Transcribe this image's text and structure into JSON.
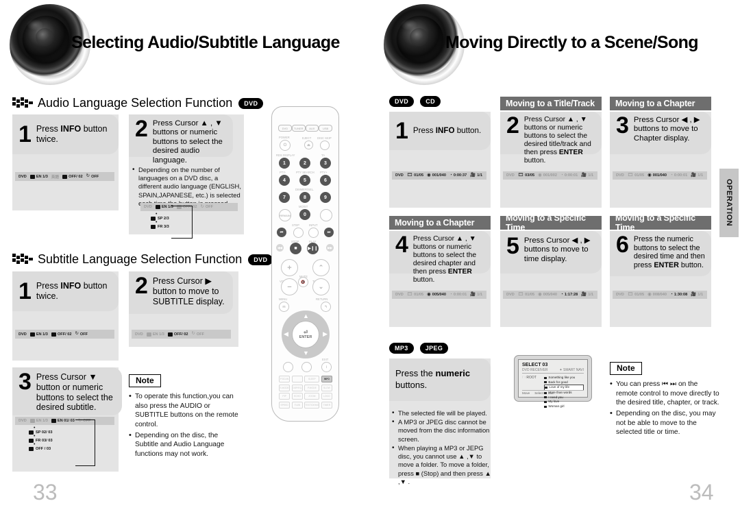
{
  "left_page": {
    "title": "Selecting Audio/Subtitle Language",
    "page_number": "33",
    "sections": [
      {
        "heading": "Audio Language Selection Function",
        "disc": "DVD",
        "steps": [
          {
            "num": "1",
            "text_plain": "Press ",
            "bold": "INFO",
            "text_rest": " button twice."
          },
          {
            "num": "2",
            "text": "Press Cursor ▲ , ▼ buttons or numeric buttons to select the desired audio language."
          }
        ],
        "step2_note": "Depending on the number of languages on a DVD disc, a different audio language (ENGLISH, SPAIN,JAPANESE, etc.) is selected each time the button is pressed.",
        "osd_step1": {
          "disc": "DVD",
          "audio": "EN 1/3",
          "audio_alt": "英語",
          "subtitle": "OFF/ 02",
          "repeat": "OFF"
        },
        "osd_step2": {
          "disc": "DVD",
          "audio": "EN 1/3",
          "subtitle": "OFF/ 02",
          "repeat": "OFF",
          "chain": [
            "SP 2/3",
            "FR 3/3"
          ]
        }
      },
      {
        "heading": "Subtitle Language Selection Function",
        "disc": "DVD",
        "steps": [
          {
            "num": "1",
            "text_plain": "Press ",
            "bold": "INFO",
            "text_rest": " button twice."
          },
          {
            "num": "2",
            "text": "Press Cursor ▶ button to move to SUBTITLE display."
          },
          {
            "num": "3",
            "text": "Press Cursor ▼ button or numeric buttons to select the desired subtitle."
          }
        ],
        "osd_step1": {
          "disc": "DVD",
          "audio": "EN 1/3",
          "subtitle": "OFF/ 02",
          "repeat": "OFF"
        },
        "osd_step2": {
          "disc": "DVD",
          "audio": "EN 1/3",
          "subtitle": "OFF/ 02",
          "repeat": "OFF"
        },
        "osd_step3": {
          "disc": "DVD",
          "audio": "EN 1/3",
          "subtitle": "EN 01/ 03",
          "repeat": "OFF",
          "chain": [
            "SP 02/ 03",
            "FR 03/ 03",
            "OFF / 03"
          ]
        },
        "note": {
          "badge": "Note",
          "items": [
            "To operate this function,you can also press the AUDIO or SUBTITLE buttons on the remote control.",
            "Depending on the disc, the Subtitle and Audio Language functions may not work."
          ]
        }
      }
    ]
  },
  "right_page": {
    "title": "Moving Directly to a Scene/Song",
    "page_number": "34",
    "disc_pills": [
      "DVD",
      "CD"
    ],
    "columns": [
      {
        "caption": "",
        "step_num": "1",
        "step_prefix": "Press ",
        "step_bold": "INFO",
        "step_suffix": " button.",
        "osd": {
          "disc": "DVD",
          "title": "01/05",
          "chapter": "001/040",
          "time": "0:00:37",
          "audio": "1/1",
          "highlight": "disc"
        }
      },
      {
        "caption": "Moving to a Title/Track",
        "step_num": "2",
        "step_text_1": "Press Cursor ▲ , ▼ buttons or numeric buttons to select the desired title/track and then press ",
        "step_bold": "ENTER",
        "step_text_2": " button.",
        "osd": {
          "disc": "DVD",
          "title": "03/05",
          "chapter": "001/002",
          "time": "0:00:01",
          "audio": "1/1",
          "highlight": "title"
        }
      },
      {
        "caption": "Moving to a Chapter",
        "step_num": "3",
        "step_text": "Press Cursor ◀ , ▶ buttons to move to Chapter display.",
        "osd": {
          "disc": "DVD",
          "title": "01/05",
          "chapter": "001/040",
          "time": "0:00:01",
          "audio": "1/1",
          "highlight": "chapter"
        }
      },
      {
        "caption": "Moving to a Chapter",
        "step_num": "4",
        "step_text_1": "Press Cursor ▲ , ▼ buttons or numeric buttons to select the desired chapter and then press ",
        "step_bold": "ENTER",
        "step_text_2": " button.",
        "osd": {
          "disc": "DVD",
          "title": "01/05",
          "chapter": "005/040",
          "time": "0:00:01",
          "audio": "1/1",
          "highlight": "chapter"
        }
      },
      {
        "caption": "Moving to a Specific Time",
        "step_num": "5",
        "step_text": "Press Cursor ◀ , ▶ buttons to move to time display.",
        "osd": {
          "disc": "DVD",
          "title": "01/05",
          "chapter": "005/040",
          "time": "1:17:28",
          "audio": "1/1",
          "highlight": "time"
        }
      },
      {
        "caption": "Moving to a Specific Time",
        "step_num": "6",
        "step_text_1": "Press the numeric buttons to select the desired time and then press ",
        "step_bold": "ENTER",
        "step_text_2": " button.",
        "osd": {
          "disc": "DVD",
          "title": "01/05",
          "chapter": "008/040",
          "time": "1:30:08",
          "audio": "1/1",
          "highlight": "time"
        }
      }
    ],
    "mp3_section": {
      "pills": [
        "MP3",
        "JPEG"
      ],
      "step_prefix": "Press the ",
      "step_bold": "numeric",
      "step_suffix": " buttons.",
      "bullets": [
        "The selected file will be played.",
        "A MP3 or JPEG disc cannot be moved from the disc information screen.",
        "When playing a MP3 or JEPG disc, you cannot use ▲ ,▼  to move a folder. To move a folder, press ■ (Stop) and then press ▲ ,▼ ."
      ],
      "tv_screen": {
        "title": "SELECT  03",
        "device": "DVD RECEIVER",
        "brand": "✦ SMART NAVI",
        "folder": "ROOT",
        "files": [
          "Something like you",
          "Back for good",
          "Love of my life",
          "More than words",
          "I need you",
          "My love",
          "Woman girl"
        ],
        "selected_index": 2,
        "footer": [
          "Move",
          "Select",
          "Exit"
        ]
      }
    },
    "note": {
      "badge": "Note",
      "items": [
        "You can press ⏮ ⏭ on the remote control to move directly to the desired title, chapter, or track.",
        "Depending on the disc, you may not be able to move to the selected title or time."
      ]
    }
  },
  "side_tab": {
    "label": "OPERATION"
  },
  "remote": {
    "source_buttons": [
      "DVD",
      "TUNER",
      "AUX",
      "USB"
    ],
    "labels": {
      "power": "POWER",
      "eject": "EJECT",
      "disc_skip": "DISC SKIP",
      "rds_display": "RDS DISPLAY",
      "ta": "TA",
      "pty_minus": "PTY-",
      "pty_search": "PTY SEARCH",
      "pty_plus": "PTY+",
      "dimmer": "DIMMER/SEL.",
      "remain": "REMAIN",
      "mo_st": "MO/ST",
      "step": "STEP",
      "input": "INPUT",
      "stop": "STOP",
      "play": "PLAY",
      "volume": "VOLUME",
      "mute": "MUTE",
      "tuning": "TUNING",
      "menu": "MENU",
      "return": "RETURN",
      "enter": "ENTER",
      "exit": "EXIT",
      "info": "INFO"
    },
    "numbers": [
      "1",
      "2",
      "3",
      "4",
      "5",
      "6",
      "7",
      "8",
      "9",
      "0"
    ],
    "bottom_keys": [
      "P.SCAN",
      "",
      "SLEEP",
      "INFO",
      "S.MODE",
      "DSP/EQ",
      "P.MODE",
      "SLOW",
      "PIP",
      "ECHO",
      "ZOOM",
      "LOGO",
      "SPEED",
      "F.A/B",
      "TEST/DEMO",
      "TIMER"
    ]
  },
  "colors": {
    "panel_grey": "#e2e2e2",
    "bubble_grey": "#dcdcdc",
    "osd_grey": "#c9c9c9",
    "caption_grey": "#6e6e6e",
    "page_number": "#bcbcbc",
    "tab_grey": "#c6c6c6"
  }
}
